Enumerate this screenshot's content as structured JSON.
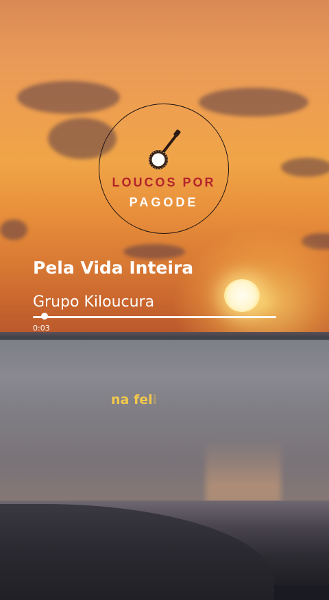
{
  "logo": {
    "line1": "LOUCOS POR",
    "line2": "PAGODE",
    "icon": "banjo-icon",
    "colors": {
      "line1": "#b3232a",
      "line2": "#ffffff"
    }
  },
  "player": {
    "song_title": "Pela Vida Inteira",
    "artist": "Grupo Kiloucura",
    "elapsed": "0:03",
    "progress_fraction": 0.047
  },
  "lyrics": {
    "current_visible": "na fel",
    "current_fading": "i"
  },
  "colors": {
    "lyric": "#f2c94c",
    "text": "#ffffff"
  }
}
